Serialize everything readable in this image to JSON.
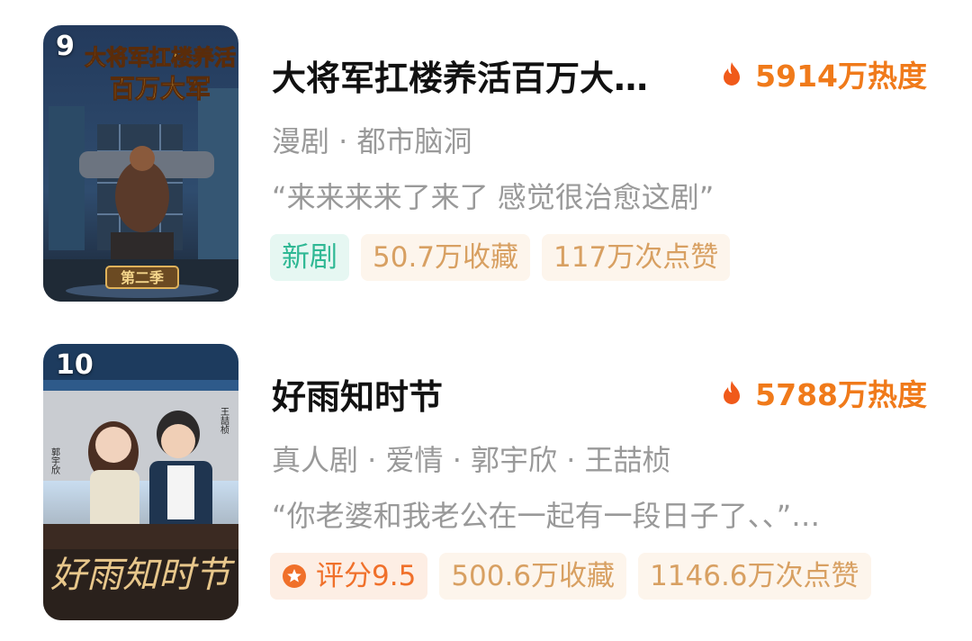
{
  "items": [
    {
      "rank": "9",
      "title": "大将军扛楼养活百万大…",
      "heat": "5914万热度",
      "meta": "漫剧 · 都市脑洞",
      "quote": "“来来来来了来了 感觉很治愈这剧”",
      "tags": [
        "新剧",
        "50.7万收藏",
        "117万次点赞"
      ],
      "poster_text": {
        "line1": "大将军扛楼养活",
        "line2": "百万大军",
        "badge": "第二季"
      }
    },
    {
      "rank": "10",
      "title": "好雨知时节",
      "heat": "5788万热度",
      "meta": "真人剧 · 爱情 · 郭宇欣 · 王喆桢",
      "quote": "“你老婆和我老公在一起有一段日子了、、”…",
      "tags": [
        "评分9.5",
        "500.6万收藏",
        "1146.6万次点赞"
      ],
      "poster_text": {
        "title": "好雨知时节",
        "cast_left": "郭宇欣",
        "cast_right": "王喆桢"
      }
    }
  ],
  "colors": {
    "heat": "#f07a1a",
    "tag_new": "#2fb894",
    "tag_stat": "#d8a062",
    "tag_score": "#f0702a"
  },
  "icons": {
    "heat": "flame-icon",
    "score": "star-badge-icon"
  }
}
